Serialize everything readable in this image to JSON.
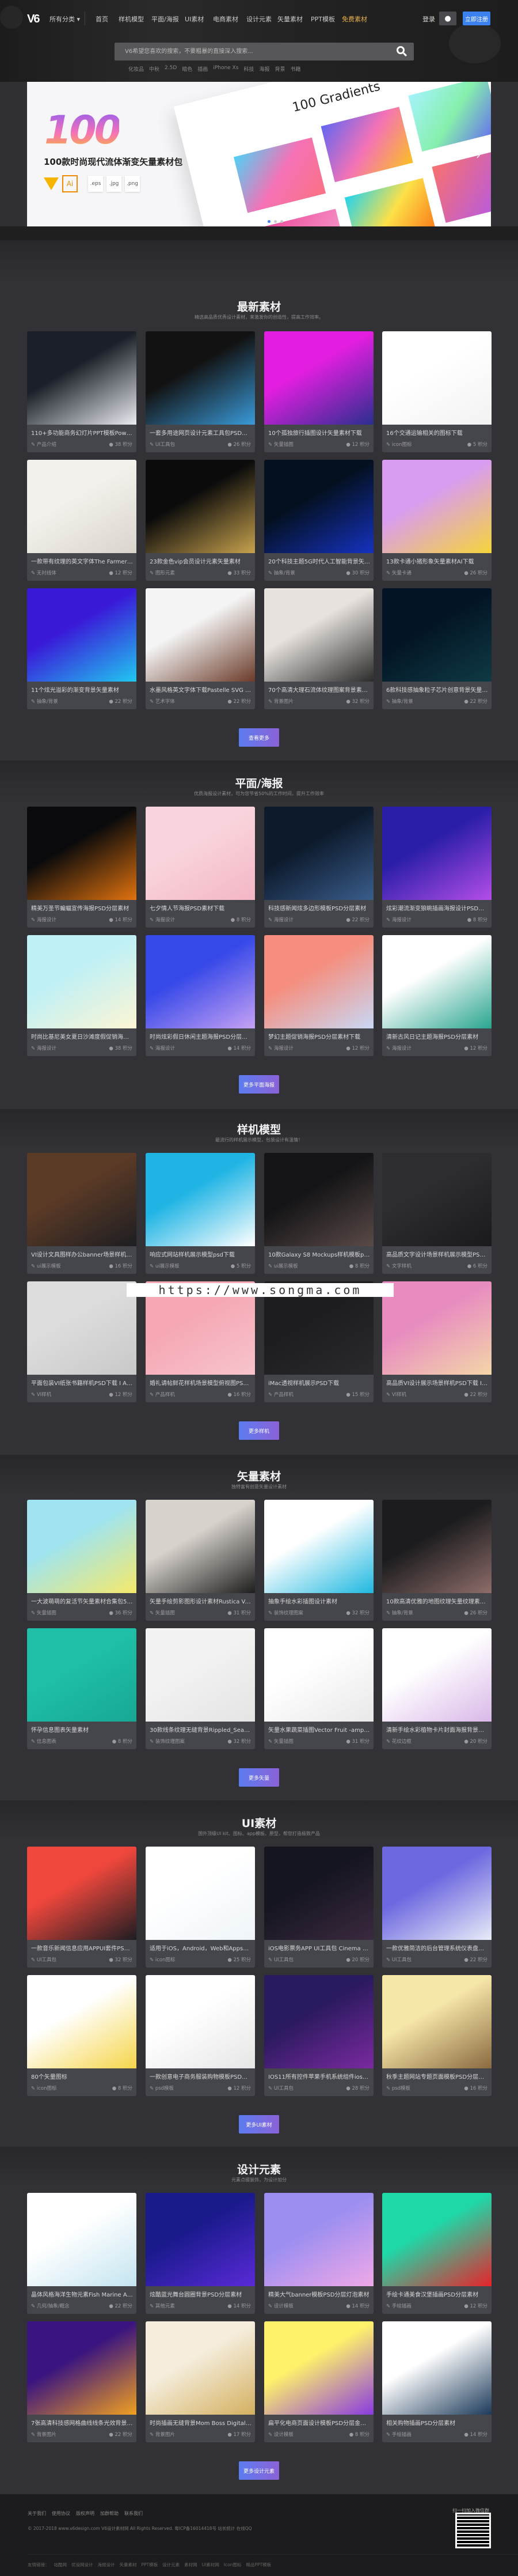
{
  "header": {
    "logo": "V6",
    "all_categories": "所有分类 ▾",
    "nav": [
      "首页",
      "样机模型",
      "平面/海报",
      "UI素材",
      "电商素材",
      "设计元素",
      "矢量素材",
      "PPT模板",
      "免费素材"
    ],
    "login": "登录",
    "qq_icon": "qq-penguin-icon",
    "register": "立即注册",
    "search_placeholder": "V6希望您喜欢的搜索，不要粗暴的直接深入搜索...",
    "hot_tags": [
      "化妆品",
      "中秋",
      "2.5D",
      "暗色",
      "插画",
      "iPhone Xs",
      "科技",
      "海报",
      "背景",
      "书籍"
    ],
    "accent_hot": "#e8b04a",
    "accent_register": "#3b82f0"
  },
  "banner": {
    "big_number": "100",
    "title": "100款时尚现代流体渐变矢量素材包",
    "formats": [
      ".eps",
      ".jpg",
      ".png"
    ],
    "ai_label": "Ai",
    "sheet_title": "100 Gradients",
    "slides": 3,
    "active_slide": 1
  },
  "category_strip": [
    "〈商务图片",
    "样机素材",
    "UI KIT",
    "PPT模板",
    "2.5D",
    "插画",
    "化妆品",
    "iPhone X〉"
  ],
  "sections": [
    {
      "title": "最新素材",
      "subtitle": "精选高品质优秀设计素材，来激发你的创造性，提高工作效率。",
      "more": "查看更多",
      "cards": [
        {
          "title": "110+多功能商务幻灯片PPT模板Powerpoi...",
          "category": "产品介绍",
          "points": "38 积分",
          "colors": [
            "#1b1f27",
            "#e9edf2"
          ]
        },
        {
          "title": "一套多用途网页设计元素工具包PSD和XD下...",
          "category": "UI工具包",
          "points": "26 积分",
          "colors": [
            "#121212",
            "#3a9ad9"
          ]
        },
        {
          "title": "10个孤独旅行插图设计矢量素材下载",
          "category": "矢量插图",
          "points": "12 积分",
          "colors": [
            "#e21ee0",
            "#2a2f8e"
          ]
        },
        {
          "title": "16个交通运输相关的图标下载",
          "category": "icon图标",
          "points": "5 积分",
          "colors": [
            "#ffffff",
            "#f2f2f2"
          ]
        },
        {
          "title": "一款带有纹理的英文字体The Farmer Font",
          "category": "无衬线体",
          "points": "12 积分",
          "colors": [
            "#f4f1ec",
            "#d9d4cc"
          ]
        },
        {
          "title": "23款金色vip会员设计元素矢量素材",
          "category": "图形元素",
          "points": "33 积分",
          "colors": [
            "#0b0b0b",
            "#c8a24e"
          ]
        },
        {
          "title": "20个科技主题5G时代人工智能背景矢量素材",
          "category": "抽象/背景",
          "points": "30 积分",
          "colors": [
            "#04101e",
            "#1532c0"
          ]
        },
        {
          "title": "13款卡通小猪形象矢量素材AI下载",
          "category": "矢量卡通",
          "points": "26 积分",
          "colors": [
            "#d99cf0",
            "#f5d53a"
          ]
        },
        {
          "title": "11个炫光溢彩的渐变背景矢量素材",
          "category": "抽象/背景",
          "points": "22 积分",
          "colors": [
            "#3a18d8",
            "#21c8f0"
          ]
        },
        {
          "title": "水墨风格英文字体下载Pastelle SVG font",
          "category": "艺术字体",
          "points": "22 积分",
          "colors": [
            "#f4f4f4",
            "#6b3b2a"
          ]
        },
        {
          "title": "70个高清大理石流体纹理图案背景素材 Lux...",
          "category": "背景图片",
          "points": "32 积分",
          "colors": [
            "#e7e2de",
            "#2b2b2b"
          ]
        },
        {
          "title": "6款科技感抽象粒子芯片创意背景矢量素材下载",
          "category": "抽象/背景",
          "points": "22 积分",
          "colors": [
            "#031424",
            "#0f3a45"
          ]
        }
      ]
    },
    {
      "title": "平面/海报",
      "subtitle": "优质海报设计素材，可为您节省50%的工作时间，提升工作效率",
      "more": "更多平面海报",
      "cards": [
        {
          "title": "精美万圣节蝙蝠宣传海报PSD分层素材",
          "category": "海报设计",
          "points": "14 积分",
          "colors": [
            "#0a0a0c",
            "#e0720e"
          ]
        },
        {
          "title": "七夕情人节海报PSD素材下载",
          "category": "海报设计",
          "points": "8 积分",
          "colors": [
            "#f9d4dc",
            "#f3b6c4"
          ]
        },
        {
          "title": "科技感新闻炫多边形模板PSD分层素材",
          "category": "海报设计",
          "points": "22 积分",
          "colors": [
            "#0d1a2c",
            "#3a5d8c"
          ]
        },
        {
          "title": "炫彩潮流渐变狼眺插画海报设计PSD分层素材",
          "category": "海报设计",
          "points": "8 积分",
          "colors": [
            "#2a1ea8",
            "#b44ee8"
          ]
        },
        {
          "title": "时尚比基尼美女夏日沙滩度假促销海报psd素...",
          "category": "海报设计",
          "points": "38 积分",
          "colors": [
            "#bff0f5",
            "#fdf5d4"
          ]
        },
        {
          "title": "时尚炫彩假日休闲主题海报PSD分层字母C素材",
          "category": "海报设计",
          "points": "14 积分",
          "colors": [
            "#3548e8",
            "#c6a1f5"
          ]
        },
        {
          "title": "梦幻主题促销海报PSD分层素材下载",
          "category": "海报设计",
          "points": "12 积分",
          "colors": [
            "#f58e7e",
            "#c8d8f5"
          ]
        },
        {
          "title": "清新古风日记主题海报PSD分层素材",
          "category": "海报设计",
          "points": "12 积分",
          "colors": [
            "#ffffff",
            "#2aa58f"
          ]
        }
      ]
    },
    {
      "title": "样机模型",
      "subtitle": "最流行的样机展示模型，包装设计有温情！",
      "more": "更多样机",
      "cards": [
        {
          "title": "VI设计文具图样办公banner场景样机PSD下...",
          "category": "ui展示模板",
          "points": "16 积分",
          "colors": [
            "#5b3a26",
            "#1e1e22"
          ]
        },
        {
          "title": "响应式网站样机展示模型psd下载",
          "category": "ui展示模板",
          "points": "5 积分",
          "colors": [
            "#1fb4e4",
            "#ffffff"
          ]
        },
        {
          "title": "10款Galaxy S8 Mockups样机模板psd下载",
          "category": "ui展示模板",
          "points": "8 积分",
          "colors": [
            "#141416",
            "#5a4a48"
          ]
        },
        {
          "title": "高品质文字设计场景样机展示模型PSD下载 I...",
          "category": "文字样机",
          "points": "6 积分",
          "colors": [
            "#2d2d30",
            "#1a1a1c"
          ]
        },
        {
          "title": "平面包装VI纸张书籍样机PSD下载 I Am Cre...",
          "category": "VI样机",
          "points": "12 积分",
          "colors": [
            "#dcdcdc",
            "#c8c8c8"
          ]
        },
        {
          "title": "婚礼请帖鲜花样机场景模型俯视图PSD下载 ...",
          "category": "产品样机",
          "points": "16 积分",
          "colors": [
            "#f5a8b4",
            "#f7c4cc"
          ]
        },
        {
          "title": "iMac透视样机展示PSD下载",
          "category": "产品样机",
          "points": "15 积分",
          "colors": [
            "#1d1d1f",
            "#2a2a2e"
          ]
        },
        {
          "title": "高品质VI设计展示场景样机PSD下载 I Am C...",
          "category": "VI样机",
          "points": "22 积分",
          "colors": [
            "#e88cc0",
            "#f3d6a8"
          ]
        }
      ]
    },
    {
      "title": "矢量素材",
      "subtitle": "独特富有创意矢量设计素材",
      "more": "更多矢量",
      "cards": [
        {
          "title": "一大波萌萌的复活节矢量素材合集包500.",
          "category": "矢量插图",
          "points": "36 积分",
          "colors": [
            "#9fe4f0",
            "#f5e96a"
          ]
        },
        {
          "title": "矢量手绘剪影图形设计素材Rustica Vol. 3 B...",
          "category": "矢量插图",
          "points": "31 积分",
          "colors": [
            "#d7d2cc",
            "#1e1e1e"
          ]
        },
        {
          "title": "抽象手绘水彩插图设计素材",
          "category": "装饰纹理图案",
          "points": "32 积分",
          "colors": [
            "#ffffff",
            "#1fb8e0"
          ]
        },
        {
          "title": "10款高清优雅的地图纹理矢量纹理素材 Map...",
          "category": "抽象/背景",
          "points": "26 积分",
          "colors": [
            "#1c1c1e",
            "#8e6d6a"
          ]
        },
        {
          "title": "怀孕信息图表矢量素材",
          "category": "信息图表",
          "points": "8 积分",
          "colors": [
            "#1fbfa8",
            "#17a894"
          ]
        },
        {
          "title": "30款线条纹理无缝背景Rippled_Seamless_...",
          "category": "装饰纹理图案",
          "points": "32 积分",
          "colors": [
            "#f2f2f2",
            "#e4e4e4"
          ]
        },
        {
          "title": "矢量水果蔬菜插图Vector Fruit -amp; Veg...",
          "category": "矢量插图",
          "points": "31 积分",
          "colors": [
            "#ffffff",
            "#e8e8e8"
          ]
        },
        {
          "title": "清新手绘水彩植物卡片封面海报背景模版矢...",
          "category": "花纹边框",
          "points": "20 积分",
          "colors": [
            "#ffffff",
            "#d9b8e8"
          ]
        }
      ]
    },
    {
      "title": "UI素材",
      "subtitle": "国外顶级UI kit、图标、app模板、原型，帮您打造极致产品",
      "more": "更多UI素材",
      "cards": [
        {
          "title": "一款音乐新闻信息应用APPUI套件PSD&Sk...",
          "category": "UI工具包",
          "points": "32 积分",
          "colors": [
            "#f0473c",
            "#1d1d22"
          ]
        },
        {
          "title": "适用于iOS，Android，Web和Apps的500...",
          "category": "icon图标",
          "points": "25 积分",
          "colors": [
            "#ffffff",
            "#eef4f8"
          ]
        },
        {
          "title": "iOS电影票务APP UI工具包 Cinema Ticket...",
          "category": "UI工具包",
          "points": "20 积分",
          "colors": [
            "#151520",
            "#3b2a40"
          ]
        },
        {
          "title": "一款优雅简洁的后台管理系统仪表盘模板下...",
          "category": "UI工具包",
          "points": "22 积分",
          "colors": [
            "#6d68e0",
            "#e8ecf8"
          ]
        },
        {
          "title": "80个矢量图标",
          "category": "icon图标",
          "points": "8 积分",
          "colors": [
            "#ffffff",
            "#f5d54a"
          ]
        },
        {
          "title": "一款创意电子商务服装购物模板PSD下载",
          "category": "psd模板",
          "points": "12 积分",
          "colors": [
            "#ffffff",
            "#e6e6e6"
          ]
        },
        {
          "title": "IOS11所有控件苹果手机系统组件ios11 uiki...",
          "category": "UI工具包",
          "points": "28 积分",
          "colors": [
            "#2a1a5e",
            "#7a2aa0"
          ]
        },
        {
          "title": "秋季主题网站专题页面模板PSD分层书本素材",
          "category": "psd模板",
          "points": "16 积分",
          "colors": [
            "#f6e6a8",
            "#8a6a40"
          ]
        }
      ]
    },
    {
      "title": "设计元素",
      "subtitle": "元素点缀装饰，为设计加分",
      "more": "更多设计元素",
      "cards": [
        {
          "title": "晶体风格海洋生物元素Fish Marine Animal...",
          "category": "几何/抽象/概念",
          "points": "22 积分",
          "colors": [
            "#ffffff",
            "#c4e4f0"
          ]
        },
        {
          "title": "炫酷蓝光舞台圆圈背景PSD分层素材",
          "category": "其他元素",
          "points": "14 积分",
          "colors": [
            "#1a1a8c",
            "#5a2ad8"
          ]
        },
        {
          "title": "精美大气banner模板PSD分层灯泡素材",
          "category": "设计模板",
          "points": "14 积分",
          "colors": [
            "#9b8ef0",
            "#f0a8e8"
          ]
        },
        {
          "title": "手绘卡通美食汉堡插画PSD分层素材",
          "category": "手绘插画",
          "points": "12 积分",
          "colors": [
            "#1ed8a8",
            "#e8232a"
          ]
        },
        {
          "title": "7张高清科技感网格曲线线条光效背景设计素...",
          "category": "背景图片",
          "points": "22 积分",
          "colors": [
            "#3a1480",
            "#f0a020"
          ]
        },
        {
          "title": "时尚插画无缝背景Mom Boss Digital Pape...",
          "category": "背景图片",
          "points": "17 积分",
          "colors": [
            "#f5eede",
            "#d4b060"
          ]
        },
        {
          "title": "扁平化电商页面设计模板PSD分层金币素材",
          "category": "设计模板",
          "points": "8 积分",
          "colors": [
            "#fff26a",
            "#8a3ae0"
          ]
        },
        {
          "title": "相关购物插画PSD分层素材",
          "category": "手绘插画",
          "points": "14 积分",
          "colors": [
            "#ffffff",
            "#1c3a5a"
          ]
        }
      ]
    }
  ],
  "watermark": "https://www.songma.com",
  "footer": {
    "links": [
      "关于我们",
      "使用协议",
      "版权声明",
      "加群帮助",
      "联系我们"
    ],
    "copyright": "© 2017-2018 www.v6design.com V6设计素材网 All Rights Reserved. 粤ICP备16014418号 站长统计  在线QQ",
    "friends_label": "友情链接：",
    "friends": [
      "站酷网",
      "优设网设计",
      "海报设计",
      "矢量素材",
      "PPT模板",
      "设计元素",
      "素材网",
      "UI素材网",
      "Icon图标",
      "精品PPT模板"
    ],
    "qr_label": "扫一扫加入微信群"
  },
  "button_gradient": [
    "#5b7cf0",
    "#8b62d8"
  ]
}
